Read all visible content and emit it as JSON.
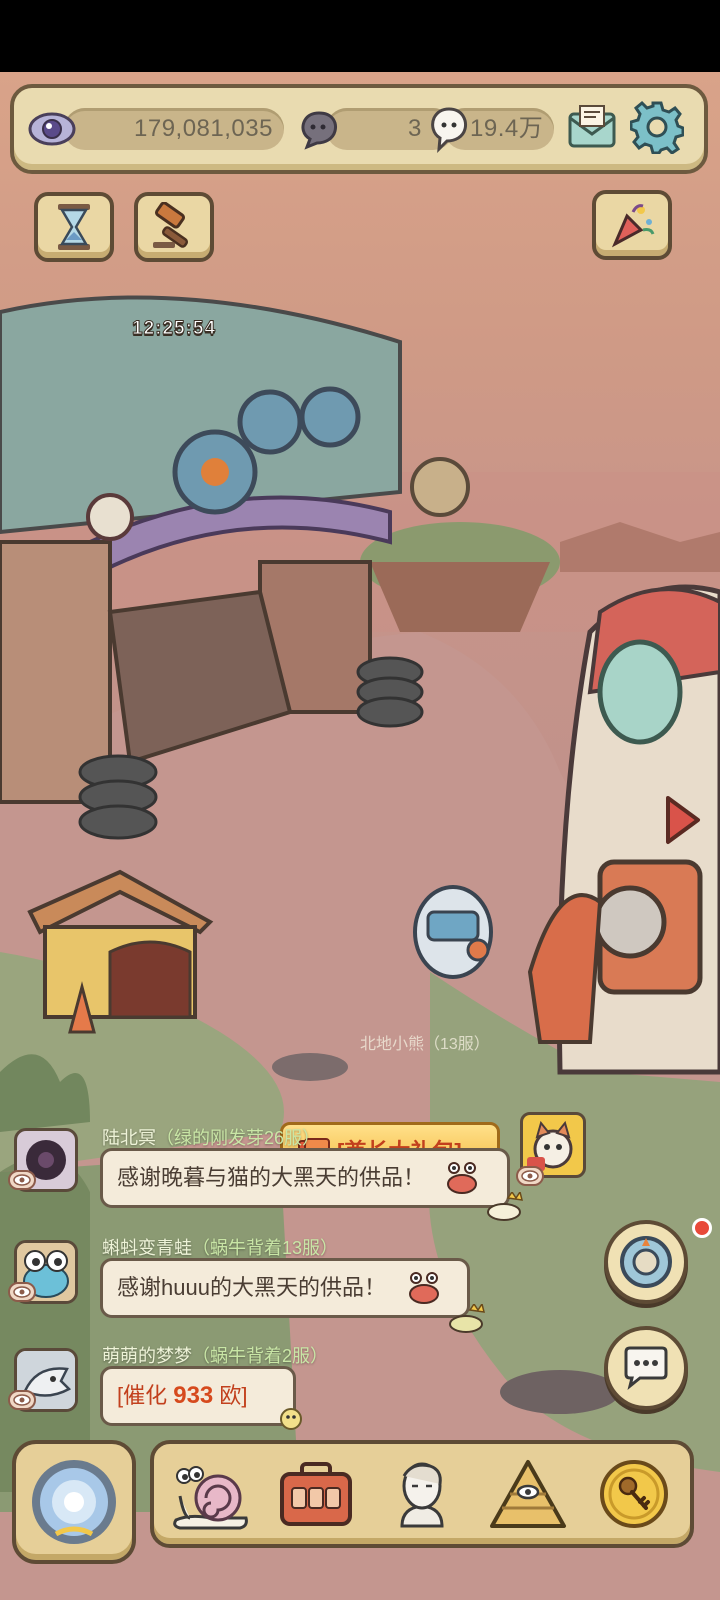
{
  "resources": {
    "eye_amount": "179,081,035",
    "bubble_count": "3",
    "ghost_amount": "19.4万"
  },
  "timer": "12:25:54",
  "gift_pack": {
    "label": "[酋长大礼包]",
    "sender_partial": "北地小熊（13服）"
  },
  "chat": [
    {
      "name": "陆北冥",
      "server": "（绿的刚发芽26服）",
      "message": "感谢晚暮与猫的大黑天的供品！"
    },
    {
      "name": "蝌蚪变青蛙",
      "server": "（蜗牛背着13服）",
      "message": "感谢huuu的大黑天的供品！"
    },
    {
      "name": "萌萌的梦梦",
      "server": "（蜗牛背着2服）",
      "message_prefix": "[催化 ",
      "message_number": "933",
      "message_suffix": " 欧]"
    }
  ],
  "icons": {
    "top": [
      "eye-icon",
      "speech-bubble-icon",
      "ghost-icon",
      "mail-icon",
      "gear-icon"
    ],
    "left_buttons": [
      "hourglass-icon",
      "auction-hammer-icon"
    ],
    "right_buttons": [
      "party-popper-icon",
      "arrow-right-icon",
      "dial-icon",
      "chat-icon"
    ],
    "nav": [
      "portal-icon",
      "snail-icon",
      "briefcase-icon",
      "bust-icon",
      "pyramid-eye-icon",
      "key-coin-icon"
    ]
  },
  "colors": {
    "accent_red": "#c2401d",
    "gold_number": "#d64a1d",
    "frame_brown": "#5e4b35"
  }
}
